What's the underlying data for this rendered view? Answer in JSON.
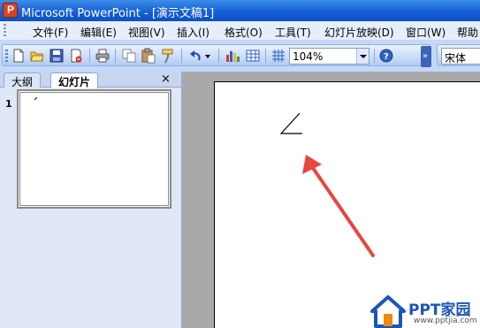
{
  "window": {
    "title": "Microsoft PowerPoint - [演示文稿1]",
    "app_icon": "powerpoint-app-icon"
  },
  "menu": {
    "items": [
      {
        "label": "文件(F)"
      },
      {
        "label": "编辑(E)"
      },
      {
        "label": "视图(V)"
      },
      {
        "label": "插入(I)"
      },
      {
        "label": "格式(O)"
      },
      {
        "label": "工具(T)"
      },
      {
        "label": "幻灯片放映(D)"
      },
      {
        "label": "窗口(W)"
      },
      {
        "label": "帮助"
      }
    ]
  },
  "toolbar": {
    "icons": [
      "new-icon",
      "open-icon",
      "save-icon",
      "permission-icon",
      "print-icon",
      "copy-icon",
      "paste-icon",
      "format-painter-icon",
      "undo-icon",
      "chart-icon",
      "table-icon",
      "grid-icon",
      "help-icon"
    ],
    "zoom_value": "104%",
    "font_value": "宋体"
  },
  "pane": {
    "tab_outline": "大纲",
    "tab_slides": "幻灯片",
    "close_glyph": "×",
    "slide_number": "1"
  },
  "annotation": {
    "arrow_color": "#e8473f"
  },
  "watermark": {
    "title": "PPT家园",
    "url": "www.pptjia.com",
    "house_color": "#1a56b8",
    "accent_color": "#f08a12"
  }
}
